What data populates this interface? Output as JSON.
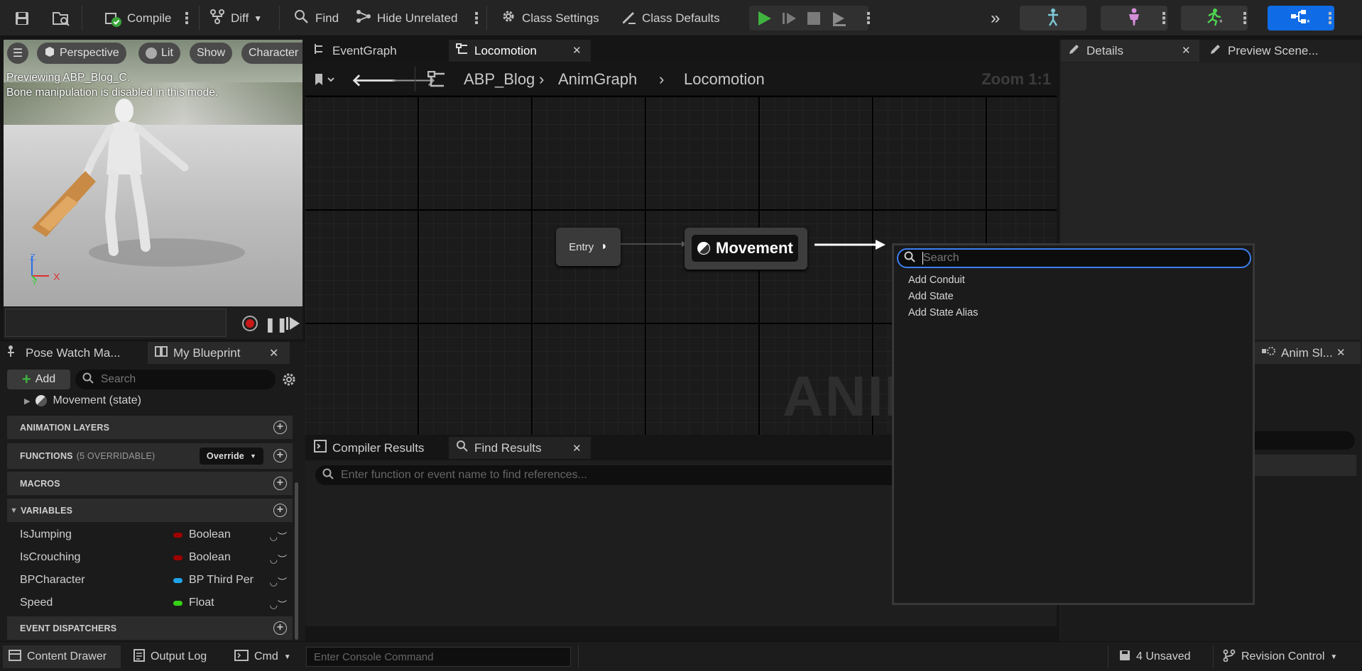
{
  "toolbar": {
    "compile_label": "Compile",
    "diff_label": "Diff",
    "find_label": "Find",
    "hide_unrelated_label": "Hide Unrelated",
    "class_settings_label": "Class Settings",
    "class_defaults_label": "Class Defaults",
    "icons": [
      "save-icon",
      "browse-icon",
      "compile-icon",
      "diff-icon",
      "find-icon",
      "hide-unrelated-icon",
      "class-settings-icon",
      "class-defaults-icon",
      "play-icon",
      "step-icon",
      "stop-icon",
      "eject-icon",
      "expand-icon",
      "skeleton-icon",
      "mesh-icon",
      "animation-icon",
      "blueprint-icon"
    ]
  },
  "viewport": {
    "perspective_label": "Perspective",
    "lit_label": "Lit",
    "show_label": "Show",
    "character_label": "Character",
    "info_line1": "Previewing ABP_Blog_C.",
    "info_line2": "Bone manipulation is disabled in this mode.",
    "axis_z": "Z",
    "axis_x": "X",
    "axis_y": "Y"
  },
  "left_tabs": {
    "pose_watch": "Pose Watch Ma...",
    "my_blueprint": "My Blueprint"
  },
  "my_blueprint": {
    "add_label": "Add",
    "search_placeholder": "Search",
    "tree_item": "Movement (state)",
    "sections": {
      "animation_layers": "ANIMATION LAYERS",
      "functions": "FUNCTIONS",
      "functions_count": "(5 OVERRIDABLE)",
      "override_label": "Override",
      "macros": "MACROS",
      "variables": "VARIABLES",
      "event_dispatchers": "EVENT DISPATCHERS"
    },
    "variables": [
      {
        "name": "IsJumping",
        "type": "Boolean",
        "color": "#a00000"
      },
      {
        "name": "IsCrouching",
        "type": "Boolean",
        "color": "#a00000"
      },
      {
        "name": "BPCharacter",
        "type": "BP Third Person Character",
        "color": "#1fa3e8"
      },
      {
        "name": "Speed",
        "type": "Float",
        "color": "#35d215"
      }
    ]
  },
  "graph_tabs": {
    "event_graph": "EventGraph",
    "locomotion": "Locomotion"
  },
  "breadcrumb": {
    "root": "ABP_Blog",
    "anim_graph": "AnimGraph",
    "current": "Locomotion",
    "zoom": "Zoom 1:1"
  },
  "graph": {
    "entry_label": "Entry",
    "state_label": "Movement",
    "watermark": "ANIMATION"
  },
  "context_menu": {
    "search_placeholder": "Search",
    "items": [
      "Add Conduit",
      "Add State",
      "Add State Alias"
    ]
  },
  "bottom_tabs": {
    "compiler_results": "Compiler Results",
    "find_results": "Find Results",
    "find_placeholder": "Enter function or event name to find references..."
  },
  "right_tabs": {
    "details": "Details",
    "preview_scene": "Preview Scene...",
    "anim_slot": "Anim Sl..."
  },
  "status_bar": {
    "content_drawer": "Content Drawer",
    "output_log": "Output Log",
    "cmd": "Cmd",
    "console_placeholder": "Enter Console Command",
    "unsaved": "4 Unsaved",
    "revision_control": "Revision Control"
  },
  "colors": {
    "accent_blue": "#0f6ce6",
    "play_green": "#3fb43f",
    "record_red": "#c91818",
    "selected_outline": "#3d7ff0"
  }
}
